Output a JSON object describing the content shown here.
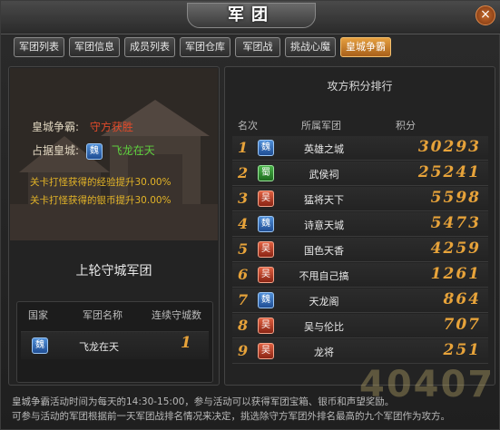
{
  "window": {
    "title": "军团",
    "close_glyph": "×"
  },
  "tabs": [
    {
      "label": "军团列表",
      "active": false
    },
    {
      "label": "军团信息",
      "active": false
    },
    {
      "label": "成员列表",
      "active": false
    },
    {
      "label": "军团仓库",
      "active": false
    },
    {
      "label": "军团战",
      "active": false
    },
    {
      "label": "挑战心魔",
      "active": false
    },
    {
      "label": "皇城争霸",
      "active": true
    }
  ],
  "left": {
    "contest_label": "皇城争霸:",
    "contest_value": "守方获胜",
    "occupy_label": "占据皇城:",
    "occupy_kingdom": "魏",
    "occupy_guild": "飞龙在天",
    "bonus_exp": "关卡打怪获得的经验提升30.00%",
    "bonus_silver": "关卡打怪获得的银币提升30.00%",
    "defender_title": "上轮守城军团",
    "def_headers": {
      "kingdom": "国家",
      "name": "军团名称",
      "streak": "连续守城数"
    },
    "def_row": {
      "kingdom": "魏",
      "name": "飞龙在天",
      "streak": "1"
    }
  },
  "right": {
    "title": "攻方积分排行",
    "headers": {
      "rank": "名次",
      "guild": "所属军团",
      "score": "积分"
    },
    "rows": [
      {
        "rank": "1",
        "kingdom": "魏",
        "kingdom_class": "wei",
        "name": "英雄之城",
        "score": "30293"
      },
      {
        "rank": "2",
        "kingdom": "蜀",
        "kingdom_class": "shu",
        "name": "武侯祠",
        "score": "25241"
      },
      {
        "rank": "3",
        "kingdom": "吴",
        "kingdom_class": "wu",
        "name": "猛将天下",
        "score": "5598"
      },
      {
        "rank": "4",
        "kingdom": "魏",
        "kingdom_class": "wei",
        "name": "诗意天城",
        "score": "5473"
      },
      {
        "rank": "5",
        "kingdom": "吴",
        "kingdom_class": "wu",
        "name": "国色天香",
        "score": "4259"
      },
      {
        "rank": "6",
        "kingdom": "吴",
        "kingdom_class": "wu",
        "name": "不甩自己搞",
        "score": "1261"
      },
      {
        "rank": "7",
        "kingdom": "魏",
        "kingdom_class": "wei",
        "name": "天龙阁",
        "score": "864"
      },
      {
        "rank": "8",
        "kingdom": "吴",
        "kingdom_class": "wu",
        "name": "吴与伦比",
        "score": "707"
      },
      {
        "rank": "9",
        "kingdom": "吴",
        "kingdom_class": "wu",
        "name": "龙将",
        "score": "251"
      }
    ]
  },
  "notice": {
    "line1": "皇城争霸活动时间为每天的14:30-15:00，参与活动可以获得军团宝箱、银币和声望奖励。",
    "line2": "可参与活动的军团根据前一天军团战排名情况来决定，挑选除守方军团外排名最高的九个军团作为攻方。"
  },
  "watermark": "40407"
}
